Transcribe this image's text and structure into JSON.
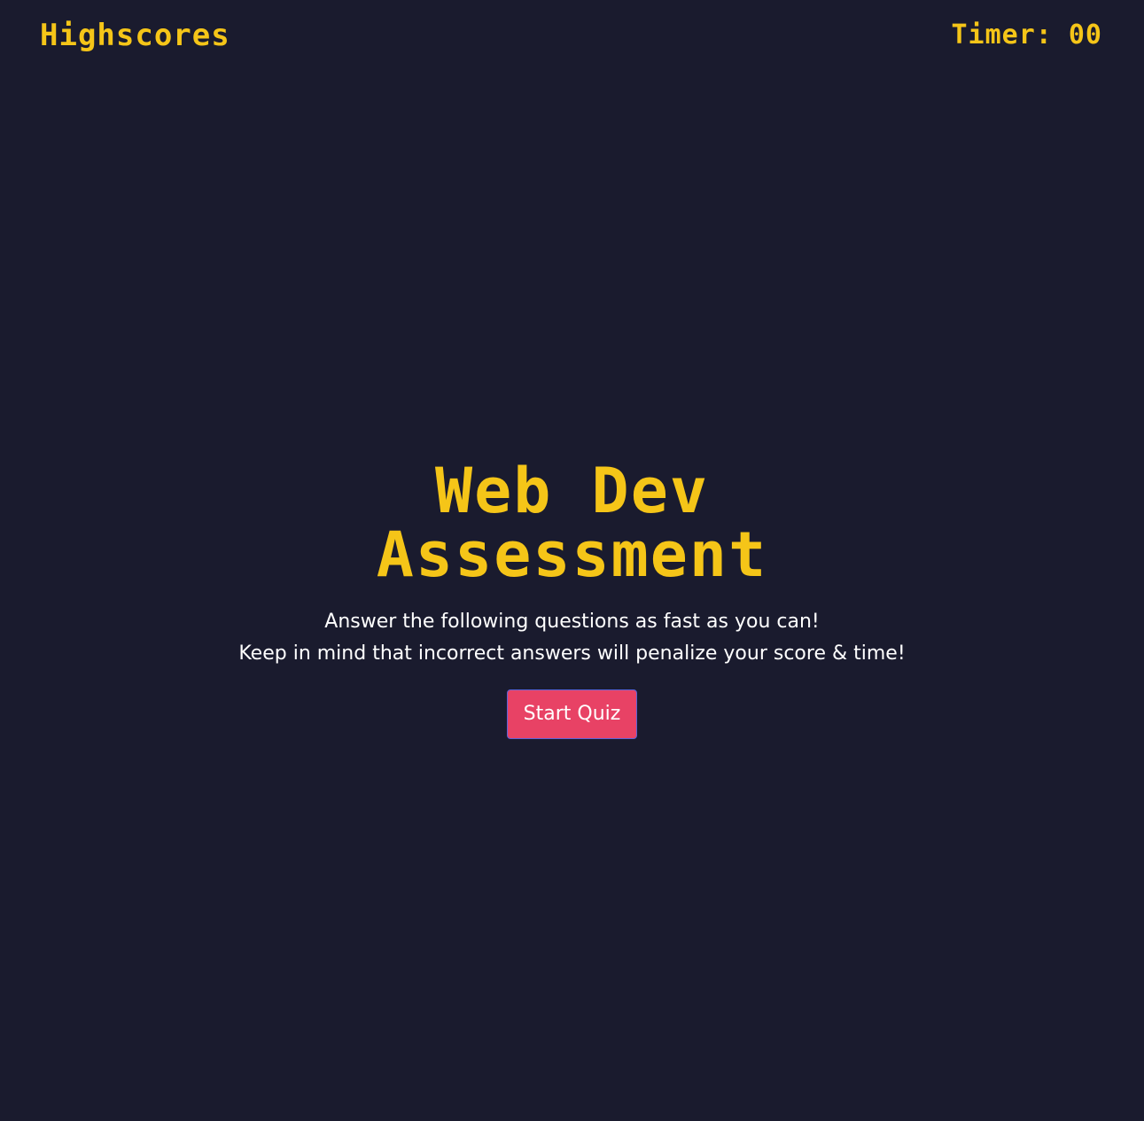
{
  "header": {
    "highscores_label": "Highscores",
    "timer_label": "Timer:",
    "timer_value": "00"
  },
  "main": {
    "title_line1": "Web Dev",
    "title_line2": "Assessment",
    "instructions_line1": "Answer the following questions as fast as you can!",
    "instructions_line2": "Keep in mind that incorrect answers will penalize your score & time!",
    "start_button_label": "Start Quiz"
  },
  "colors": {
    "background": "#1a1b2e",
    "accent_yellow": "#f5c518",
    "button_red": "#e84265",
    "button_border": "#5b63d8",
    "text_white": "#ffffff"
  }
}
